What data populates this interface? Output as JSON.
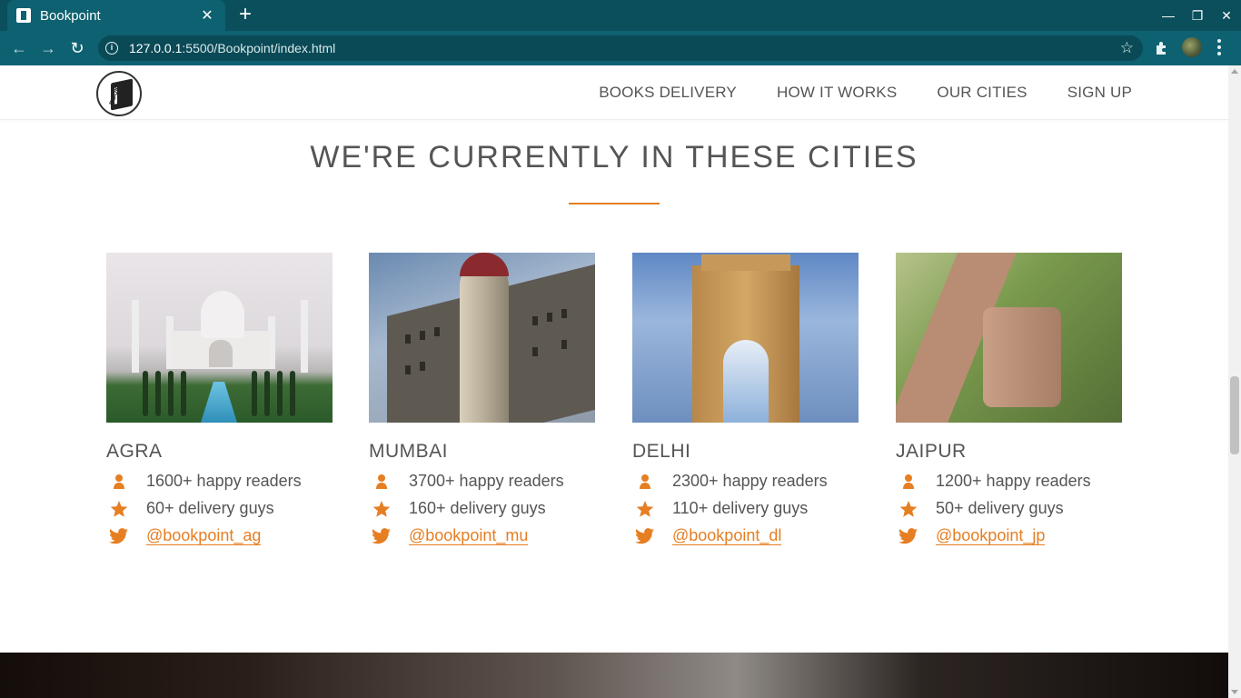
{
  "browser": {
    "tab_title": "Bookpoint",
    "url_host": "127.0.0.1",
    "url_rest": ":5500/Bookpoint/index.html"
  },
  "nav": {
    "links": [
      "BOOKS DELIVERY",
      "HOW IT WORKS",
      "OUR CITIES",
      "SIGN UP"
    ],
    "logo_text": "BOOK"
  },
  "section": {
    "title": "WE'RE CURRENTLY IN THESE CITIES",
    "accent_color": "#e67e22"
  },
  "cities": [
    {
      "name": "AGRA",
      "readers": "1600+ happy readers",
      "delivery": "60+ delivery guys",
      "twitter": "@bookpoint_ag"
    },
    {
      "name": "MUMBAI",
      "readers": "3700+ happy readers",
      "delivery": "160+ delivery guys",
      "twitter": "@bookpoint_mu"
    },
    {
      "name": "DELHI",
      "readers": "2300+ happy readers",
      "delivery": "110+ delivery guys",
      "twitter": "@bookpoint_dl"
    },
    {
      "name": "JAIPUR",
      "readers": "1200+ happy readers",
      "delivery": "50+ delivery guys",
      "twitter": "@bookpoint_jp"
    }
  ],
  "icons": {
    "readers": "person-icon",
    "delivery": "star-icon",
    "twitter": "twitter-icon"
  }
}
